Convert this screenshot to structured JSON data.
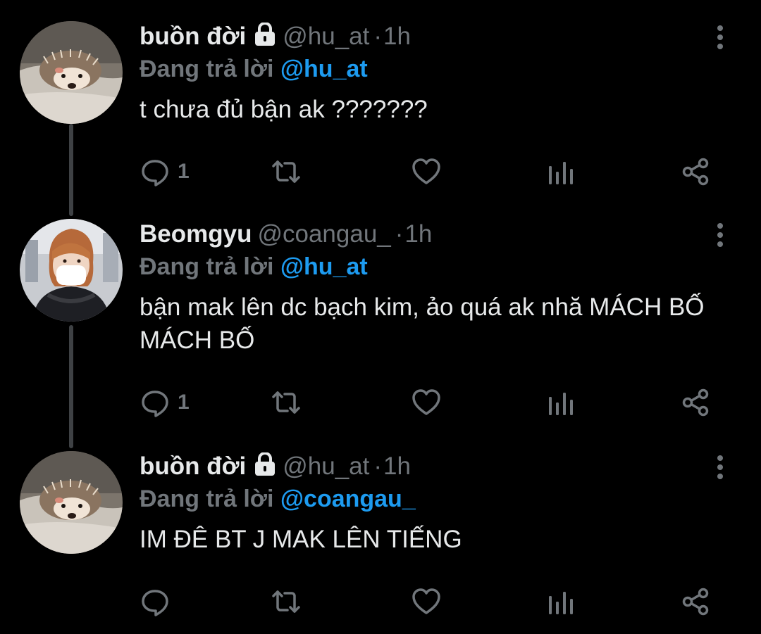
{
  "tweets": [
    {
      "display_name": "buồn đời",
      "locked": true,
      "handle": "@hu_at",
      "dot": "·",
      "time": "1h",
      "reply_prefix": "Đang trả lời",
      "reply_to": "@hu_at",
      "text": "t chưa đủ bận ak ???????",
      "reply_count": "1",
      "avatar": "hedgehog"
    },
    {
      "display_name": "Beomgyu",
      "locked": false,
      "handle": "@coangau_",
      "dot": "·",
      "time": "1h",
      "reply_prefix": "Đang trả lời",
      "reply_to": "@hu_at",
      "text": "bận mak lên dc bạch kim, ảo quá ak nhă MÁCH BỐ MÁCH BỐ",
      "reply_count": "1",
      "avatar": "person-mask"
    },
    {
      "display_name": "buồn đời",
      "locked": true,
      "handle": "@hu_at",
      "dot": "·",
      "time": "1h",
      "reply_prefix": "Đang trả lời",
      "reply_to": "@coangau_",
      "text": "IM ĐÊ BT J MAK LÊN TIẾNG",
      "reply_count": "",
      "avatar": "hedgehog"
    }
  ],
  "icons": [
    "lock-icon",
    "more-vertical-icon",
    "reply-icon",
    "retweet-icon",
    "like-icon",
    "views-icon",
    "share-icon"
  ],
  "colors": {
    "background": "#000000",
    "primary_text": "#e7e9ea",
    "secondary_text": "#71767b",
    "link": "#1d9bf0",
    "thread_line": "#3e4144"
  }
}
